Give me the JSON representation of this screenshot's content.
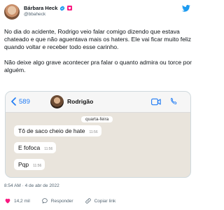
{
  "author": {
    "display_name": "Bárbara Heck",
    "handle": "@bbaheck"
  },
  "tweet": {
    "paragraphs": [
      "No dia do acidente, Rodrigo veio falar comigo dizendo que estava chateado e que não aguentava mais os haters. Ele vai ficar muito feliz quando voltar e receber todo esse carinho.",
      "Não deixe algo grave acontecer pra falar o quanto admira ou torce por alguém."
    ],
    "timestamp": "8:54 AM · 4 de abr de 2022"
  },
  "chat": {
    "back_count": "589",
    "contact_name": "Rodrigão",
    "date_label": "quarta-feira",
    "messages": [
      {
        "text": "Tô de saco cheio de hate",
        "time": "11:56"
      },
      {
        "text": "E fofoca",
        "time": "11:56"
      },
      {
        "text": "Pqp",
        "time": "11:56"
      }
    ]
  },
  "actions": {
    "likes": "14,2 mil",
    "reply": "Responder",
    "copy_link": "Copiar link"
  },
  "colors": {
    "twitter_blue": "#1d9bf0",
    "whatsapp_blue": "#1f7bf4",
    "heart_red": "#f91880",
    "chat_background": "#e9e4dc"
  },
  "icons": [
    "verified-icon",
    "heart-emoji-icon",
    "twitter-bird-icon",
    "back-chevron-icon",
    "video-call-icon",
    "phone-icon",
    "like-icon",
    "reply-icon",
    "link-icon"
  ]
}
